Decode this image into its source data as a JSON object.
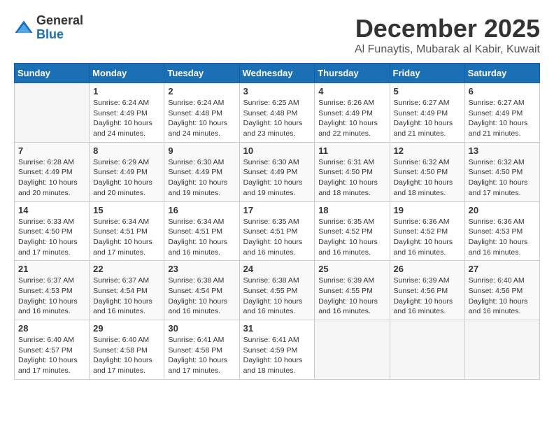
{
  "logo": {
    "general": "General",
    "blue": "Blue"
  },
  "header": {
    "title": "December 2025",
    "subtitle": "Al Funaytis, Mubarak al Kabir, Kuwait"
  },
  "weekdays": [
    "Sunday",
    "Monday",
    "Tuesday",
    "Wednesday",
    "Thursday",
    "Friday",
    "Saturday"
  ],
  "weeks": [
    [
      {
        "day": "",
        "info": ""
      },
      {
        "day": "1",
        "info": "Sunrise: 6:24 AM\nSunset: 4:49 PM\nDaylight: 10 hours\nand 24 minutes."
      },
      {
        "day": "2",
        "info": "Sunrise: 6:24 AM\nSunset: 4:48 PM\nDaylight: 10 hours\nand 24 minutes."
      },
      {
        "day": "3",
        "info": "Sunrise: 6:25 AM\nSunset: 4:48 PM\nDaylight: 10 hours\nand 23 minutes."
      },
      {
        "day": "4",
        "info": "Sunrise: 6:26 AM\nSunset: 4:49 PM\nDaylight: 10 hours\nand 22 minutes."
      },
      {
        "day": "5",
        "info": "Sunrise: 6:27 AM\nSunset: 4:49 PM\nDaylight: 10 hours\nand 21 minutes."
      },
      {
        "day": "6",
        "info": "Sunrise: 6:27 AM\nSunset: 4:49 PM\nDaylight: 10 hours\nand 21 minutes."
      }
    ],
    [
      {
        "day": "7",
        "info": "Sunrise: 6:28 AM\nSunset: 4:49 PM\nDaylight: 10 hours\nand 20 minutes."
      },
      {
        "day": "8",
        "info": "Sunrise: 6:29 AM\nSunset: 4:49 PM\nDaylight: 10 hours\nand 20 minutes."
      },
      {
        "day": "9",
        "info": "Sunrise: 6:30 AM\nSunset: 4:49 PM\nDaylight: 10 hours\nand 19 minutes."
      },
      {
        "day": "10",
        "info": "Sunrise: 6:30 AM\nSunset: 4:49 PM\nDaylight: 10 hours\nand 19 minutes."
      },
      {
        "day": "11",
        "info": "Sunrise: 6:31 AM\nSunset: 4:50 PM\nDaylight: 10 hours\nand 18 minutes."
      },
      {
        "day": "12",
        "info": "Sunrise: 6:32 AM\nSunset: 4:50 PM\nDaylight: 10 hours\nand 18 minutes."
      },
      {
        "day": "13",
        "info": "Sunrise: 6:32 AM\nSunset: 4:50 PM\nDaylight: 10 hours\nand 17 minutes."
      }
    ],
    [
      {
        "day": "14",
        "info": "Sunrise: 6:33 AM\nSunset: 4:50 PM\nDaylight: 10 hours\nand 17 minutes."
      },
      {
        "day": "15",
        "info": "Sunrise: 6:34 AM\nSunset: 4:51 PM\nDaylight: 10 hours\nand 17 minutes."
      },
      {
        "day": "16",
        "info": "Sunrise: 6:34 AM\nSunset: 4:51 PM\nDaylight: 10 hours\nand 16 minutes."
      },
      {
        "day": "17",
        "info": "Sunrise: 6:35 AM\nSunset: 4:51 PM\nDaylight: 10 hours\nand 16 minutes."
      },
      {
        "day": "18",
        "info": "Sunrise: 6:35 AM\nSunset: 4:52 PM\nDaylight: 10 hours\nand 16 minutes."
      },
      {
        "day": "19",
        "info": "Sunrise: 6:36 AM\nSunset: 4:52 PM\nDaylight: 10 hours\nand 16 minutes."
      },
      {
        "day": "20",
        "info": "Sunrise: 6:36 AM\nSunset: 4:53 PM\nDaylight: 10 hours\nand 16 minutes."
      }
    ],
    [
      {
        "day": "21",
        "info": "Sunrise: 6:37 AM\nSunset: 4:53 PM\nDaylight: 10 hours\nand 16 minutes."
      },
      {
        "day": "22",
        "info": "Sunrise: 6:37 AM\nSunset: 4:54 PM\nDaylight: 10 hours\nand 16 minutes."
      },
      {
        "day": "23",
        "info": "Sunrise: 6:38 AM\nSunset: 4:54 PM\nDaylight: 10 hours\nand 16 minutes."
      },
      {
        "day": "24",
        "info": "Sunrise: 6:38 AM\nSunset: 4:55 PM\nDaylight: 10 hours\nand 16 minutes."
      },
      {
        "day": "25",
        "info": "Sunrise: 6:39 AM\nSunset: 4:55 PM\nDaylight: 10 hours\nand 16 minutes."
      },
      {
        "day": "26",
        "info": "Sunrise: 6:39 AM\nSunset: 4:56 PM\nDaylight: 10 hours\nand 16 minutes."
      },
      {
        "day": "27",
        "info": "Sunrise: 6:40 AM\nSunset: 4:56 PM\nDaylight: 10 hours\nand 16 minutes."
      }
    ],
    [
      {
        "day": "28",
        "info": "Sunrise: 6:40 AM\nSunset: 4:57 PM\nDaylight: 10 hours\nand 17 minutes."
      },
      {
        "day": "29",
        "info": "Sunrise: 6:40 AM\nSunset: 4:58 PM\nDaylight: 10 hours\nand 17 minutes."
      },
      {
        "day": "30",
        "info": "Sunrise: 6:41 AM\nSunset: 4:58 PM\nDaylight: 10 hours\nand 17 minutes."
      },
      {
        "day": "31",
        "info": "Sunrise: 6:41 AM\nSunset: 4:59 PM\nDaylight: 10 hours\nand 18 minutes."
      },
      {
        "day": "",
        "info": ""
      },
      {
        "day": "",
        "info": ""
      },
      {
        "day": "",
        "info": ""
      }
    ]
  ]
}
